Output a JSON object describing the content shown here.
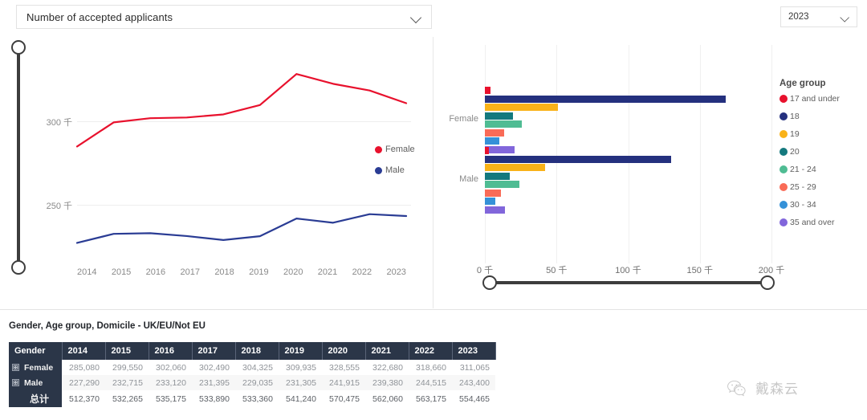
{
  "controls": {
    "measure_label": "Number of accepted applicants",
    "measure_icon": "chevron-down-icon",
    "year_value": "2023",
    "year_icon": "chevron-down-icon"
  },
  "line_panel": {
    "legend": [
      {
        "label": "Female",
        "color": "#E8112D"
      },
      {
        "label": "Male",
        "color": "#2A3C94"
      }
    ]
  },
  "bar_panel": {
    "legend_title": "Age group",
    "legend": [
      {
        "label": "17 and under",
        "color": "#E8112D"
      },
      {
        "label": "18",
        "color": "#24307E"
      },
      {
        "label": "19",
        "color": "#F9B218"
      },
      {
        "label": "20",
        "color": "#14797E"
      },
      {
        "label": "21 - 24",
        "color": "#4FBC93"
      },
      {
        "label": "25 - 29",
        "color": "#F96B57"
      },
      {
        "label": "30 - 34",
        "color": "#3591D8"
      },
      {
        "label": "35 and over",
        "color": "#8166DB"
      }
    ]
  },
  "table": {
    "title": "Gender, Age group, Domicile - UK/EU/Not EU",
    "corner_header": "Gender",
    "columns": [
      "2014",
      "2015",
      "2016",
      "2017",
      "2018",
      "2019",
      "2020",
      "2021",
      "2022",
      "2023"
    ],
    "rows": [
      {
        "label": "Female",
        "expandable": true,
        "values": [
          "285,080",
          "299,550",
          "302,060",
          "302,490",
          "304,325",
          "309,935",
          "328,555",
          "322,680",
          "318,660",
          "311,065"
        ]
      },
      {
        "label": "Male",
        "expandable": true,
        "values": [
          "227,290",
          "232,715",
          "233,120",
          "231,395",
          "229,035",
          "231,305",
          "241,915",
          "239,380",
          "244,515",
          "243,400"
        ]
      },
      {
        "label": "总计",
        "expandable": false,
        "values": [
          "512,370",
          "532,265",
          "535,175",
          "533,890",
          "533,360",
          "541,240",
          "570,475",
          "562,060",
          "563,175",
          "554,465"
        ]
      }
    ]
  },
  "watermark": {
    "text": "戴森云",
    "icon": "wechat-icon"
  },
  "chart_data": [
    {
      "type": "line",
      "title": "",
      "xlabel": "",
      "ylabel": "",
      "categories": [
        "2014",
        "2015",
        "2016",
        "2017",
        "2018",
        "2019",
        "2020",
        "2021",
        "2022",
        "2023"
      ],
      "ytick_labels": [
        "300 千",
        "250 千"
      ],
      "ytick_values": [
        300000,
        250000
      ],
      "ylim": [
        215000,
        345000
      ],
      "grid": true,
      "legend_position": "right",
      "series": [
        {
          "name": "Female",
          "color": "#E8112D",
          "values": [
            285080,
            299550,
            302060,
            302490,
            304325,
            309935,
            328555,
            322680,
            318660,
            311065
          ]
        },
        {
          "name": "Male",
          "color": "#2A3C94",
          "values": [
            227290,
            232715,
            233120,
            231395,
            229035,
            231305,
            241915,
            239380,
            244515,
            243400
          ]
        }
      ]
    },
    {
      "type": "bar",
      "orientation": "horizontal",
      "title": "",
      "xlabel": "",
      "ylabel": "",
      "xtick_labels": [
        "0 千",
        "50 千",
        "100 千",
        "150 千",
        "200 千"
      ],
      "xtick_values": [
        0,
        50000,
        100000,
        150000,
        200000
      ],
      "xlim": [
        0,
        200000
      ],
      "grid": true,
      "legend_title": "Age group",
      "legend_position": "right",
      "categories": [
        "Female",
        "Male"
      ],
      "series": [
        {
          "name": "17 and under",
          "color": "#E8112D",
          "values": [
            4200,
            2800
          ]
        },
        {
          "name": "18",
          "color": "#24307E",
          "values": [
            168000,
            130000
          ]
        },
        {
          "name": "19",
          "color": "#F9B218",
          "values": [
            51000,
            42000
          ]
        },
        {
          "name": "20",
          "color": "#14797E",
          "values": [
            19500,
            17500
          ]
        },
        {
          "name": "21 - 24",
          "color": "#4FBC93",
          "values": [
            26000,
            24000
          ]
        },
        {
          "name": "25 - 29",
          "color": "#F96B57",
          "values": [
            13500,
            11000
          ]
        },
        {
          "name": "30 - 34",
          "color": "#3591D8",
          "values": [
            10000,
            7500
          ]
        },
        {
          "name": "35 and over",
          "color": "#8166DB",
          "values": [
            21000,
            14000
          ]
        }
      ]
    }
  ]
}
